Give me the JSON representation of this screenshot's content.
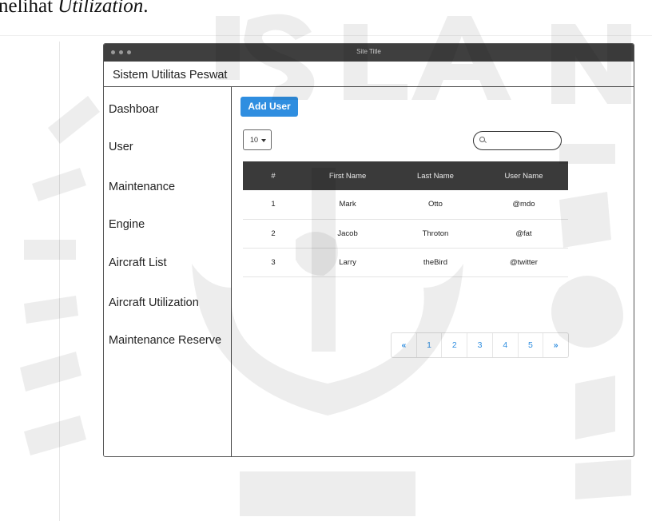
{
  "document": {
    "top_text_prefix": "nelihat ",
    "top_text_italic": "Utilization",
    "top_text_suffix": "."
  },
  "window": {
    "title": "Site Title",
    "app_title": "Sistem Utilitas Peswat"
  },
  "sidebar": {
    "items": [
      {
        "label": "Dashboar"
      },
      {
        "label": "User"
      },
      {
        "label": "Maintenance"
      },
      {
        "label": "Engine"
      },
      {
        "label": "Aircraft List"
      },
      {
        "label": "Aircraft Utilization"
      },
      {
        "label": "Maintenance Reserve"
      }
    ]
  },
  "main": {
    "add_user_label": "Add User",
    "page_size": "10",
    "search_placeholder": "",
    "table": {
      "headers": [
        "#",
        "First Name",
        "Last Name",
        "User Name"
      ],
      "rows": [
        [
          "1",
          "Mark",
          "Otto",
          "@mdo"
        ],
        [
          "2",
          "Jacob",
          "Throton",
          "@fat"
        ],
        [
          "3",
          "Larry",
          "theBird",
          "@twitter"
        ]
      ]
    },
    "pagination": [
      "«",
      "1",
      "2",
      "3",
      "4",
      "5",
      "»"
    ]
  },
  "colors": {
    "accent": "#2f8ee0",
    "header_bg": "#3a3a3a",
    "titlebar_bg": "#3f3f3f"
  },
  "watermark": {
    "icon": "university-seal-watermark"
  }
}
